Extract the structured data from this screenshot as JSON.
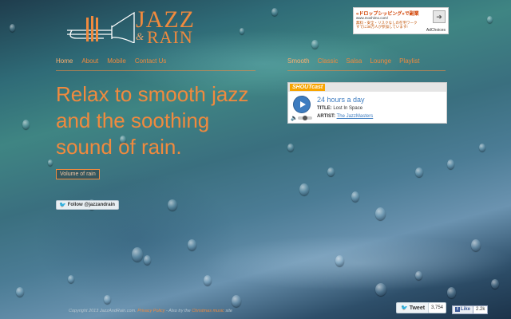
{
  "colors": {
    "accent": "#f08a3e",
    "player_blue": "#3d7cc0"
  },
  "logo": {
    "jazz": "JAZZ",
    "amp": "&",
    "rain": "RAIN"
  },
  "nav_left": [
    "Home",
    "About",
    "Mobile",
    "Contact Us"
  ],
  "nav_right": [
    "Smooth",
    "Classic",
    "Salsa",
    "Lounge",
    "Playlist"
  ],
  "headline": "Relax to smooth jazz and the soothing sound of rain.",
  "volume_button": "Volume of rain",
  "twitter_follow": "Follow @jazzandrain",
  "ad": {
    "title": "«ドロップシッピング»で副業",
    "url": "www.moshimo.com/",
    "line1": "無料・安全・リスクなしの在宅ワーク",
    "line2": "すでに38万人が参加しています!",
    "choices": "AdChoices"
  },
  "player": {
    "brand": "SHOUTcast",
    "station": "24 hours a day",
    "title_label": "TITLE:",
    "title_value": "Lost In Space",
    "artist_label": "ARTIST:",
    "artist_value": "The JazzMasters"
  },
  "footer": {
    "copyright": "Copyright 2013 JazzAndRain.com. ",
    "privacy": "Privacy Policy",
    "also": " - Also try the ",
    "christmas": "Christmas music",
    "site": " site"
  },
  "social": {
    "tweet": "Tweet",
    "tweet_count": "3,754",
    "like": "Like",
    "like_count": "2.2k"
  }
}
